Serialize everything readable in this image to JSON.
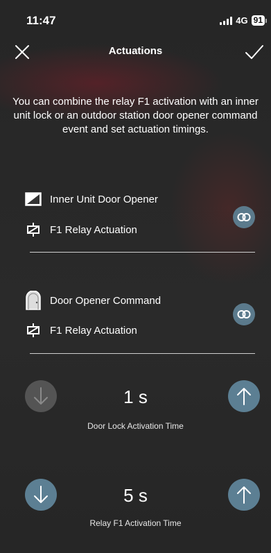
{
  "status_bar": {
    "time": "11:47",
    "network": "4G",
    "battery": "91"
  },
  "header": {
    "title": "Actuations"
  },
  "description": "You can combine the relay F1 activation with an inner unit lock or an outdoor station door opener command event and set actuation timings.",
  "groups": [
    {
      "first_label": "Inner Unit Door Opener",
      "first_icon": "inner-unit-door-icon",
      "second_label": "F1 Relay Actuation",
      "second_icon": "relay-icon"
    },
    {
      "first_label": "Door Opener Command",
      "first_icon": "door-icon",
      "second_label": "F1 Relay Actuation",
      "second_icon": "relay-icon"
    }
  ],
  "timers": [
    {
      "value": "1 s",
      "label": "Door Lock Activation Time",
      "decrease_enabled": false
    },
    {
      "value": "5 s",
      "label": "Relay F1 Activation Time",
      "decrease_enabled": true
    }
  ],
  "colors": {
    "accent": "#5c7f93",
    "disabled": "#545454",
    "background": "#262626"
  }
}
